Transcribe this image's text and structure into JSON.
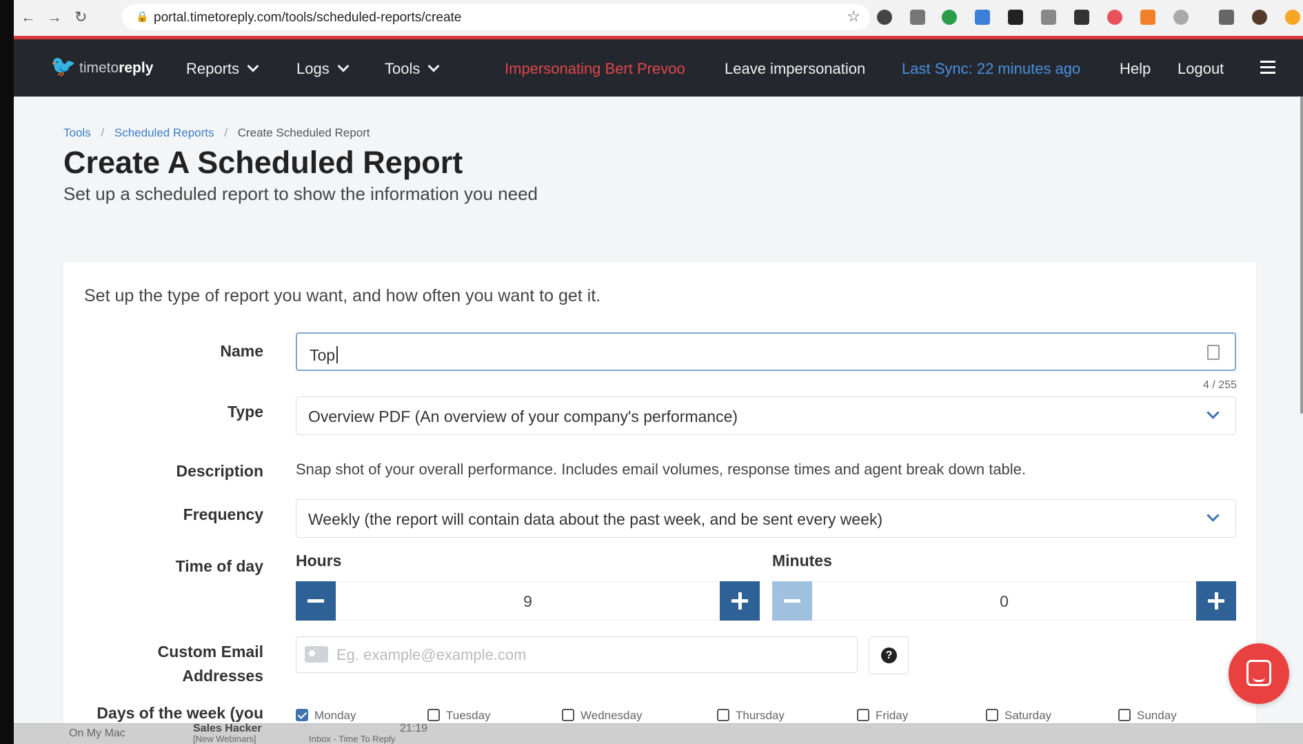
{
  "browser": {
    "url": "portal.timetoreply.com/tools/scheduled-reports/create",
    "back": "←",
    "forward": "→",
    "reload": "↻",
    "star": "☆"
  },
  "navbar": {
    "brand_light": "timeto",
    "brand_bold": "reply",
    "items": [
      {
        "label": "Reports"
      },
      {
        "label": "Logs"
      },
      {
        "label": "Tools"
      }
    ],
    "impersonating": "Impersonating Bert Prevoo",
    "leave": "Leave impersonation",
    "last_sync": "Last Sync: 22 minutes ago",
    "help": "Help",
    "logout": "Logout"
  },
  "breadcrumb": {
    "tools": "Tools",
    "scheduled_reports": "Scheduled Reports",
    "current": "Create Scheduled Report",
    "sep": "/"
  },
  "page": {
    "title": "Create A Scheduled Report",
    "subtitle": "Set up a scheduled report to show the information you need"
  },
  "form": {
    "intro": "Set up the type of report you want, and how often you want to get it.",
    "name": {
      "label": "Name",
      "value": "Top",
      "count": "4 / 255"
    },
    "type": {
      "label": "Type",
      "value": "Overview PDF (An overview of your company's performance)"
    },
    "description": {
      "label": "Description",
      "value": "Snap shot of your overall performance. Includes email volumes, response times and agent break down table."
    },
    "frequency": {
      "label": "Frequency",
      "value": "Weekly (the report will contain data about the past week, and be sent every week)"
    },
    "time_of_day": {
      "label": "Time of day",
      "hours_label": "Hours",
      "hours_value": "9",
      "minutes_label": "Minutes",
      "minutes_value": "0"
    },
    "custom_email": {
      "label_line1": "Custom Email",
      "label_line2": "Addresses",
      "placeholder": "Eg. example@example.com",
      "help": "?"
    },
    "days": {
      "label": "Days of the week (you",
      "items": [
        {
          "label": "Monday",
          "checked": true
        },
        {
          "label": "Tuesday",
          "checked": false
        },
        {
          "label": "Wednesday",
          "checked": false
        },
        {
          "label": "Thursday",
          "checked": false
        },
        {
          "label": "Friday",
          "checked": false
        },
        {
          "label": "Saturday",
          "checked": false
        },
        {
          "label": "Sunday",
          "checked": false
        }
      ]
    }
  },
  "overlay": {
    "item1": "On My Mac",
    "item2": "Sales Hacker",
    "item3": "[New Webinars]",
    "item4": "21:19",
    "item5": "Inbox - Time To Reply"
  },
  "colors": {
    "accent": "#2e6196",
    "navbar": "#24282e",
    "impersonating": "#e0454b",
    "sync": "#4a8fe0",
    "chat": "#e8413f"
  }
}
